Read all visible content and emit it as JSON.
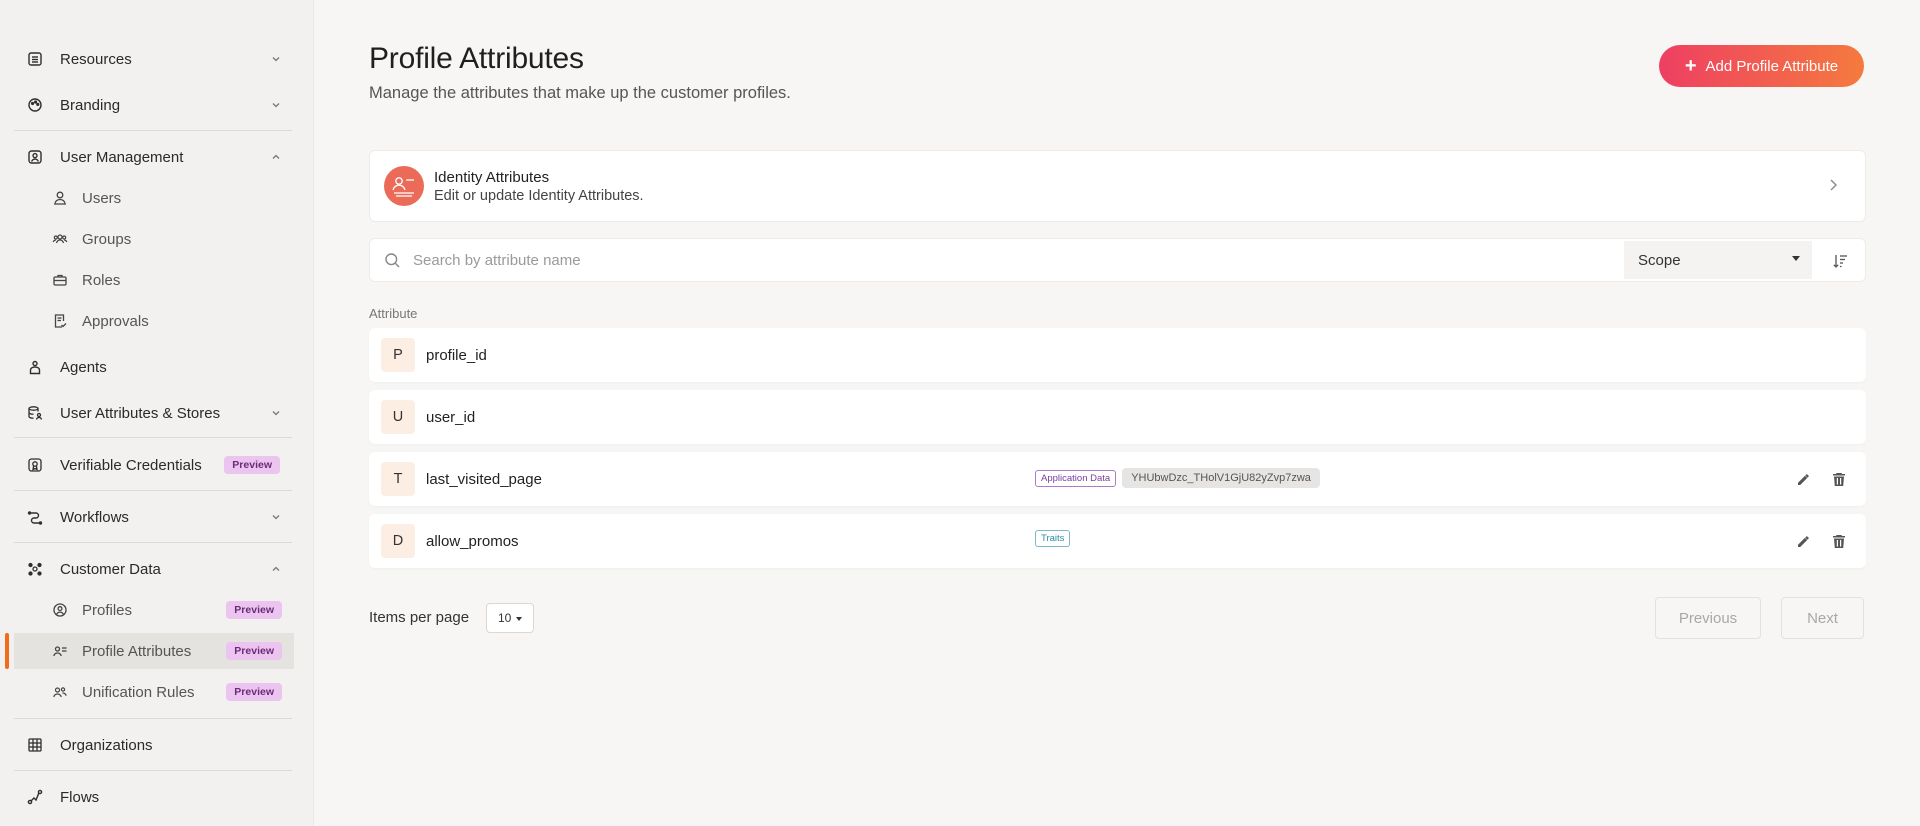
{
  "sidebar": {
    "items": [
      {
        "label": "Resources"
      },
      {
        "label": "Branding"
      },
      {
        "label": "User Management"
      },
      {
        "label": "Agents"
      },
      {
        "label": "User Attributes & Stores"
      },
      {
        "label": "Verifiable Credentials",
        "badge": "Preview"
      },
      {
        "label": "Workflows"
      },
      {
        "label": "Customer Data"
      },
      {
        "label": "Organizations"
      },
      {
        "label": "Flows"
      }
    ],
    "user_management_children": [
      {
        "label": "Users"
      },
      {
        "label": "Groups"
      },
      {
        "label": "Roles"
      },
      {
        "label": "Approvals"
      }
    ],
    "customer_data_children": [
      {
        "label": "Profiles",
        "badge": "Preview"
      },
      {
        "label": "Profile Attributes",
        "badge": "Preview"
      },
      {
        "label": "Unification Rules",
        "badge": "Preview"
      }
    ],
    "active_item": "Profile Attributes",
    "accent_color": "#f26a1b"
  },
  "header": {
    "title": "Profile Attributes",
    "subtitle": "Manage the attributes that make up the customer profiles.",
    "add_button_label": "Add Profile Attribute"
  },
  "identity_card": {
    "title": "Identity Attributes",
    "description": "Edit or update Identity Attributes."
  },
  "filter": {
    "search_placeholder": "Search by attribute name",
    "scope_label": "Scope"
  },
  "table": {
    "column_header": "Attribute",
    "rows": [
      {
        "letter": "P",
        "name": "profile_id"
      },
      {
        "letter": "U",
        "name": "user_id"
      },
      {
        "letter": "T",
        "name": "last_visited_page",
        "tag": "Application Data",
        "app_id": "YHUbwDzc_THolV1GjU82yZvp7zwa"
      },
      {
        "letter": "D",
        "name": "allow_promos",
        "tag": "Traits"
      }
    ]
  },
  "pagination": {
    "items_per_page_label": "Items per page",
    "items_per_page_value": "10",
    "previous_label": "Previous",
    "next_label": "Next"
  }
}
